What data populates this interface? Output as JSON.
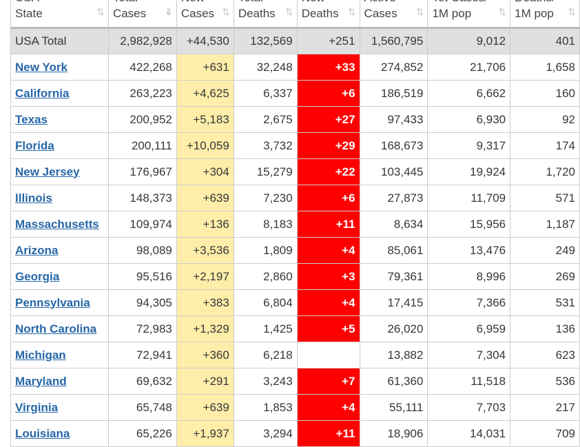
{
  "columns": [
    {
      "l1": "USA",
      "l2": "State"
    },
    {
      "l1": "Total",
      "l2": "Cases",
      "sorted": true
    },
    {
      "l1": "New",
      "l2": "Cases"
    },
    {
      "l1": "Total",
      "l2": "Deaths"
    },
    {
      "l1": "New",
      "l2": "Deaths"
    },
    {
      "l1": "Active",
      "l2": "Cases"
    },
    {
      "l1": "Tot Cases/",
      "l2": "1M pop"
    },
    {
      "l1": "Deaths/",
      "l2": "1M pop"
    }
  ],
  "colors": {
    "new_cases_bg": "#ffeeaa",
    "new_deaths_bg": "#ff0000",
    "link": "#2767a8",
    "total_row_bg": "#e0e0e0"
  },
  "total": [
    "USA Total",
    "2,982,928",
    "+44,530",
    "132,569",
    "+251",
    "1,560,795",
    "9,012",
    "401"
  ],
  "rows": [
    [
      "New York",
      "422,268",
      "+631",
      "32,248",
      "+33",
      "274,852",
      "21,706",
      "1,658"
    ],
    [
      "California",
      "263,223",
      "+4,625",
      "6,337",
      "+6",
      "186,519",
      "6,662",
      "160"
    ],
    [
      "Texas",
      "200,952",
      "+5,183",
      "2,675",
      "+27",
      "97,433",
      "6,930",
      "92"
    ],
    [
      "Florida",
      "200,111",
      "+10,059",
      "3,732",
      "+29",
      "168,673",
      "9,317",
      "174"
    ],
    [
      "New Jersey",
      "176,967",
      "+304",
      "15,279",
      "+22",
      "103,445",
      "19,924",
      "1,720"
    ],
    [
      "Illinois",
      "148,373",
      "+639",
      "7,230",
      "+6",
      "27,873",
      "11,709",
      "571"
    ],
    [
      "Massachusetts",
      "109,974",
      "+136",
      "8,183",
      "+11",
      "8,634",
      "15,956",
      "1,187"
    ],
    [
      "Arizona",
      "98,089",
      "+3,536",
      "1,809",
      "+4",
      "85,061",
      "13,476",
      "249"
    ],
    [
      "Georgia",
      "95,516",
      "+2,197",
      "2,860",
      "+3",
      "79,361",
      "8,996",
      "269"
    ],
    [
      "Pennsylvania",
      "94,305",
      "+383",
      "6,804",
      "+4",
      "17,415",
      "7,366",
      "531"
    ],
    [
      "North Carolina",
      "72,983",
      "+1,329",
      "1,425",
      "+5",
      "26,020",
      "6,959",
      "136"
    ],
    [
      "Michigan",
      "72,941",
      "+360",
      "6,218",
      "",
      "13,882",
      "7,304",
      "623"
    ],
    [
      "Maryland",
      "69,632",
      "+291",
      "3,243",
      "+7",
      "61,360",
      "11,518",
      "536"
    ],
    [
      "Virginia",
      "65,748",
      "+639",
      "1,853",
      "+4",
      "55,111",
      "7,703",
      "217"
    ],
    [
      "Louisiana",
      "65,226",
      "+1,937",
      "3,294",
      "+11",
      "18,906",
      "14,031",
      "709"
    ]
  ]
}
